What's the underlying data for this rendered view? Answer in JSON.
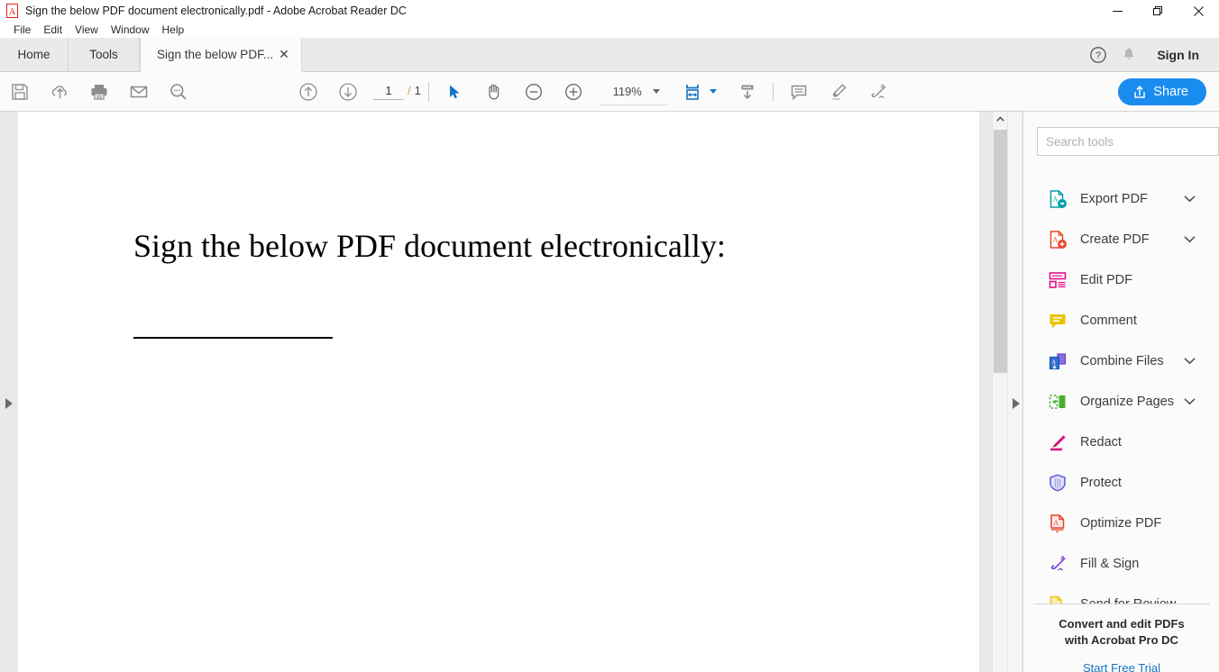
{
  "window": {
    "title": "Sign the below PDF document electronically.pdf - Adobe Acrobat Reader DC",
    "app_icon": "acrobat-icon",
    "controls": {
      "minimize": "—",
      "restore": "❐",
      "close": "✕"
    }
  },
  "menubar": {
    "items": [
      {
        "label": "File"
      },
      {
        "label": "Edit"
      },
      {
        "label": "View"
      },
      {
        "label": "Window"
      },
      {
        "label": "Help"
      }
    ]
  },
  "tabs": {
    "home": "Home",
    "tools": "Tools",
    "document": "Sign the below PDF...",
    "close_glyph": "✕",
    "help_icon": "help-circle-icon",
    "bell_icon": "bell-icon",
    "sign_in": "Sign In"
  },
  "toolbar": {
    "left_icons": [
      {
        "name": "save-icon",
        "title": "Save File"
      },
      {
        "name": "cloud-upload-icon",
        "title": "Save to Cloud"
      },
      {
        "name": "print-icon",
        "title": "Print File"
      },
      {
        "name": "email-icon",
        "title": "Email File"
      },
      {
        "name": "search-icon",
        "title": "Find"
      }
    ],
    "page_up_icon": "arrow-up-circle-icon",
    "page_down_icon": "arrow-down-circle-icon",
    "page_current": "1",
    "page_separator": "/",
    "page_total": "1",
    "select_tool_icon": "cursor-select-icon",
    "hand_tool_icon": "hand-pan-icon",
    "zoom_out_icon": "zoom-out-icon",
    "zoom_in_icon": "zoom-in-icon",
    "zoom_level": "119%",
    "fit_width_icon": "fit-page-width-icon",
    "scroll_mode_icon": "scroll-page-down-icon",
    "comment_icon": "comment-bubble-icon",
    "highlight_icon": "highlighter-pen-icon",
    "sign_icon": "sign-document-icon",
    "share_label": "Share",
    "share_icon": "share-upload-icon",
    "share_color": "#1a8cf0"
  },
  "document": {
    "heading": "Sign the below PDF document electronically:",
    "signature_line": true,
    "background": "#e9e9e9",
    "page_color": "#ffffff"
  },
  "scrollbar": {
    "up_arrow_icon": "chevron-up-icon",
    "collapse_left_icon": "triangle-right-icon",
    "collapse_right_icon": "triangle-right-icon"
  },
  "tools_panel": {
    "search": {
      "placeholder": "Search tools",
      "value": ""
    },
    "items": [
      {
        "label": "Export PDF",
        "icon": "export-pdf-icon",
        "color": "#00a0a8",
        "expandable": true
      },
      {
        "label": "Create PDF",
        "icon": "create-pdf-icon",
        "color": "#e8452b",
        "expandable": true
      },
      {
        "label": "Edit PDF",
        "icon": "edit-pdf-icon",
        "color": "#e5108b",
        "expandable": false
      },
      {
        "label": "Comment",
        "icon": "comment-icon",
        "color": "#e8c400",
        "expandable": false
      },
      {
        "label": "Combine Files",
        "icon": "combine-files-icon",
        "color": "#6c3fd1",
        "expandable": true
      },
      {
        "label": "Organize Pages",
        "icon": "organize-pages-icon",
        "color": "#4caf2f",
        "expandable": true
      },
      {
        "label": "Redact",
        "icon": "redact-icon",
        "color": "#d6197d",
        "expandable": false
      },
      {
        "label": "Protect",
        "icon": "protect-icon",
        "color": "#5a5ae0",
        "expandable": false
      },
      {
        "label": "Optimize PDF",
        "icon": "optimize-pdf-icon",
        "color": "#e8452b",
        "expandable": false
      },
      {
        "label": "Fill & Sign",
        "icon": "fill-sign-icon",
        "color": "#7b3fd1",
        "expandable": false
      },
      {
        "label": "Send for Review",
        "icon": "send-review-icon",
        "color": "#f0c419",
        "expandable": false
      }
    ],
    "promo": {
      "line1": "Convert and edit PDFs",
      "line2": "with Acrobat Pro DC",
      "link": "Start Free Trial",
      "link_color": "#1473c6"
    }
  }
}
